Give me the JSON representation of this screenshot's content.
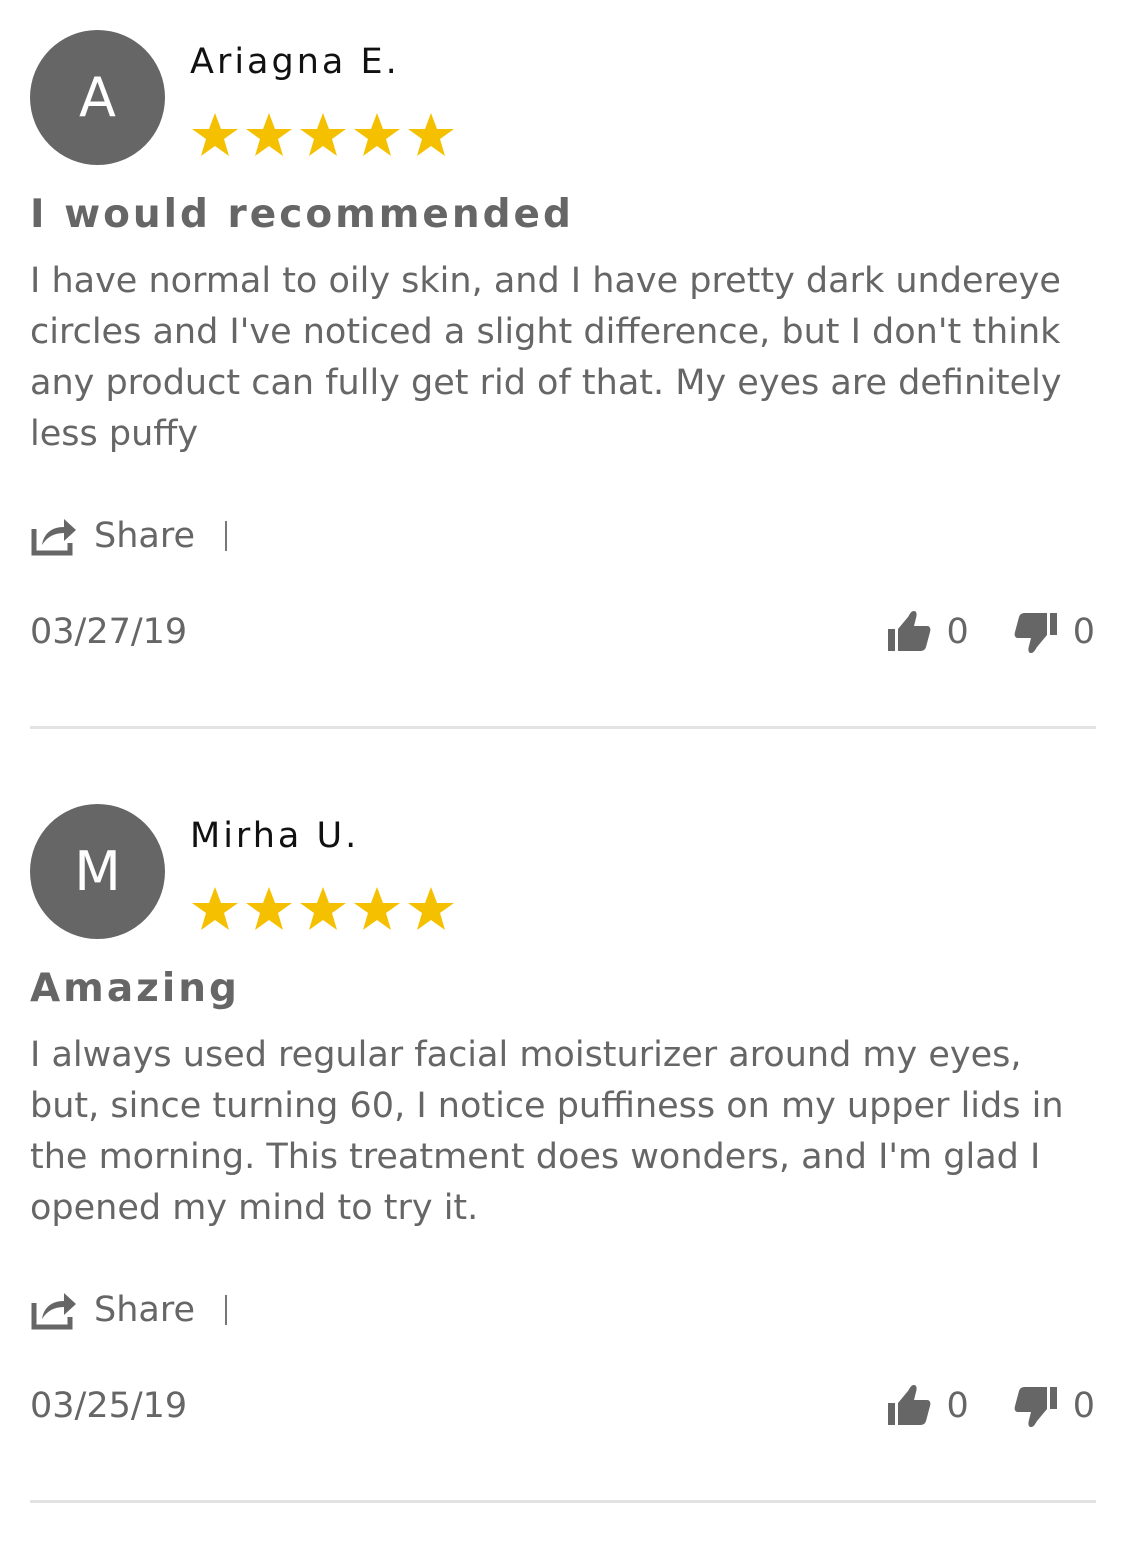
{
  "colors": {
    "avatar_bg": "#666666",
    "star": "#f5c000",
    "text": "#666666",
    "author": "#111111",
    "divider": "#e3e3e3"
  },
  "reviews": [
    {
      "avatar_letter": "A",
      "author": "Ariagna E.",
      "rating": 5,
      "title": "I would recommended",
      "body": "I have normal to oily skin, and I have pretty dark undereye circles and I've noticed a slight difference, but I don't think any product can fully get rid of that. My eyes are definitely less puffy",
      "share_label": "Share",
      "date": "03/27/19",
      "upvotes": "0",
      "downvotes": "0"
    },
    {
      "avatar_letter": "M",
      "author": "Mirha U.",
      "rating": 5,
      "title": "Amazing",
      "body": "I always used regular facial moisturizer around my eyes, but, since turning 60, I notice puffiness on my upper lids in the morning. This treatment does wonders, and I'm glad I opened my mind to try it.",
      "share_label": "Share",
      "date": "03/25/19",
      "upvotes": "0",
      "downvotes": "0"
    }
  ],
  "icons": {
    "share": "share-icon",
    "thumbs_up": "thumbs-up-icon",
    "thumbs_down": "thumbs-down-icon",
    "star": "star-icon"
  }
}
